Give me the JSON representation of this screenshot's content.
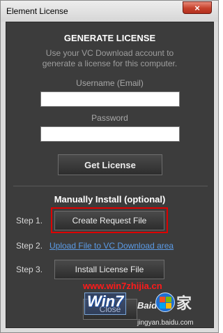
{
  "window": {
    "title": "Element License",
    "close_glyph": "×"
  },
  "generate": {
    "heading": "GENERATE LICENSE",
    "description_line1": "Use your VC Download account to",
    "description_line2": "generate a license for this computer.",
    "username_label": "Username (Email)",
    "username_value": "",
    "password_label": "Password",
    "password_value": "",
    "get_license_label": "Get License"
  },
  "manual": {
    "heading": "Manually Install (optional)",
    "step1_label": "Step 1.",
    "step1_button": "Create Request File",
    "step2_label": "Step 2.",
    "step2_link": "Upload File to VC Download area",
    "step3_label": "Step 3.",
    "step3_button": "Install License File"
  },
  "footer": {
    "close_label": "Close"
  },
  "watermark": {
    "url": "www.win7zhijia.cn",
    "brand": "Win7",
    "jia_char": "家",
    "baidu_text": "Baidu",
    "baidu_domain": "jingyan.baidu.com"
  },
  "colors": {
    "panel_bg": "#3c3c3c",
    "link": "#5b9be6",
    "highlight_border": "#dd0000",
    "close_button": "#c6412c"
  }
}
